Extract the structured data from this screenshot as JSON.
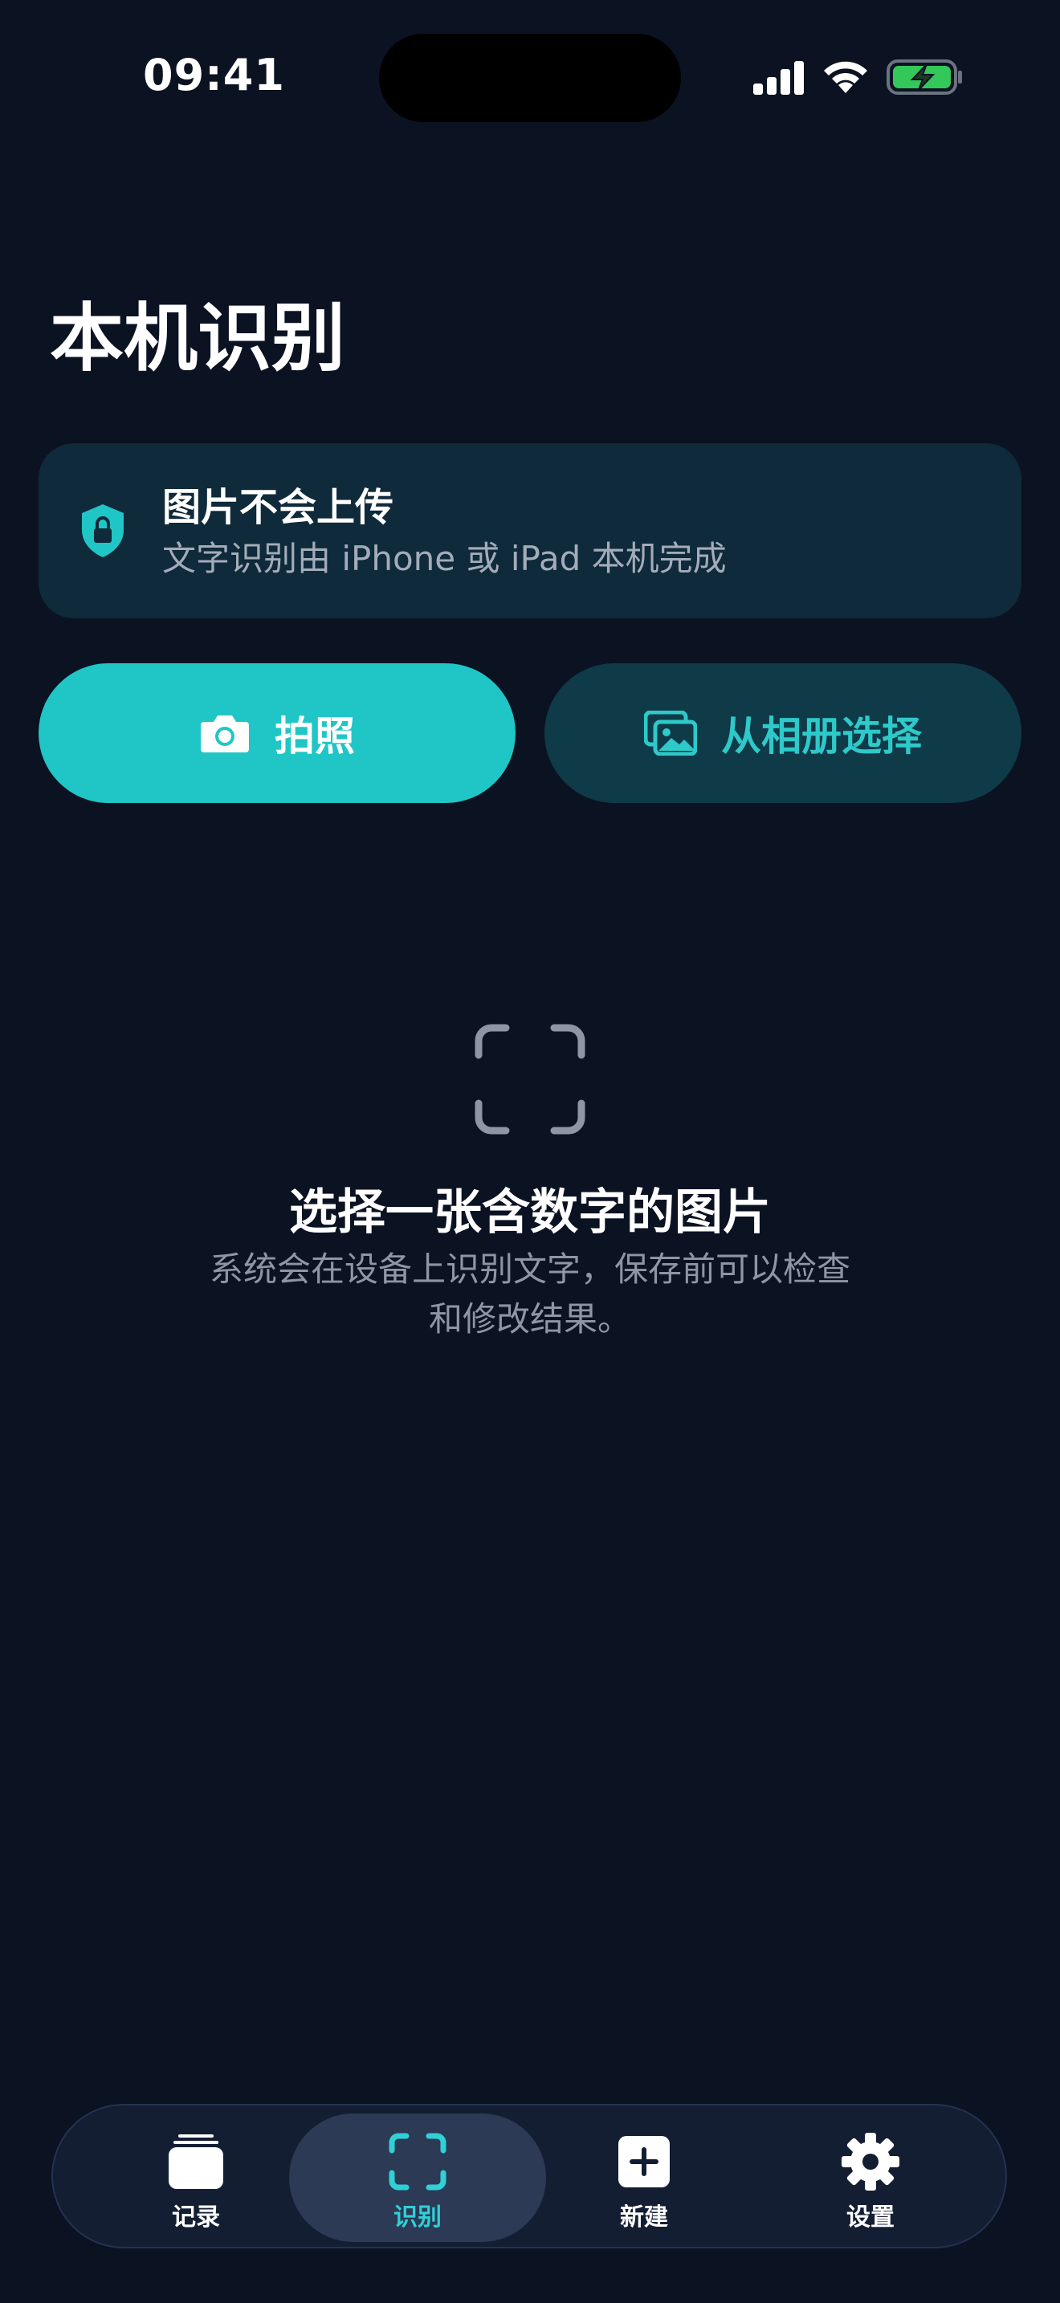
{
  "status_bar": {
    "time": "09:41"
  },
  "page": {
    "title": "本机识别"
  },
  "privacy_card": {
    "icon": "shield-lock-icon",
    "title": "图片不会上传",
    "description": "文字识别由 iPhone 或 iPad 本机完成"
  },
  "actions": {
    "camera_label": "拍照",
    "camera_icon": "camera-icon",
    "album_label": "从相册选择",
    "album_icon": "photo-library-icon"
  },
  "empty_state": {
    "icon": "scan-frame-icon",
    "title": "选择一张含数字的图片",
    "description": "系统会在设备上识别文字，保存前可以检查和修改结果。"
  },
  "tab_bar": {
    "tabs": [
      {
        "label": "记录",
        "icon": "records-stack-icon",
        "active": false
      },
      {
        "label": "识别",
        "icon": "scan-icon",
        "active": true
      },
      {
        "label": "新建",
        "icon": "plus-square-icon",
        "active": false
      },
      {
        "label": "设置",
        "icon": "gear-icon",
        "active": false
      }
    ]
  },
  "colors": {
    "background": "#0b1222",
    "accent": "#20c6c6",
    "card": "#0f2a3a",
    "secondary_button": "#0f3a48"
  }
}
